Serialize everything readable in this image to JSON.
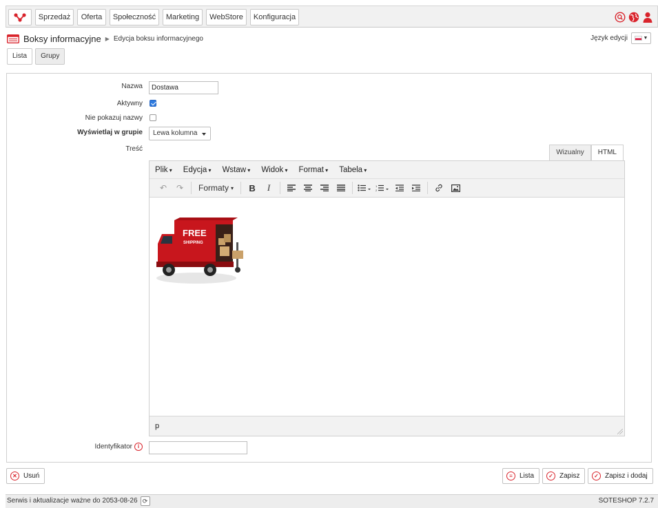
{
  "nav": {
    "items": [
      {
        "label": "Sprzedaż"
      },
      {
        "label": "Oferta"
      },
      {
        "label": "Społeczność"
      },
      {
        "label": "Marketing"
      },
      {
        "label": "WebStore"
      },
      {
        "label": "Konfiguracja"
      }
    ],
    "right_icons": [
      "search-icon",
      "globe-icon",
      "user-icon"
    ]
  },
  "header": {
    "title": "Boksy informacyjne",
    "subtitle": "Edycja boksu informacyjnego",
    "lang_label": "Język edycji",
    "lang_flag": "PL"
  },
  "subtabs": [
    {
      "label": "Lista"
    },
    {
      "label": "Grupy"
    }
  ],
  "form": {
    "name_label": "Nazwa",
    "name_value": "Dostawa",
    "active_label": "Aktywny",
    "active_checked": true,
    "hide_name_label": "Nie pokazuj nazwy",
    "hide_name_checked": false,
    "group_label": "Wyświetlaj w grupie",
    "group_value": "Lewa kolumna",
    "content_label": "Treść",
    "identifier_label": "Identyfikator",
    "identifier_value": ""
  },
  "editor": {
    "mode_tabs": [
      {
        "label": "Wizualny"
      },
      {
        "label": "HTML"
      }
    ],
    "menu": [
      "Plik",
      "Edycja",
      "Wstaw",
      "Widok",
      "Format",
      "Tabela"
    ],
    "formats_label": "Formaty",
    "image_text": {
      "line1": "FREE",
      "line2": "SHIPPING"
    },
    "status_path": "p"
  },
  "actions": {
    "delete": "Usuń",
    "list": "Lista",
    "save": "Zapisz",
    "save_add": "Zapisz i dodaj"
  },
  "footer": {
    "service_text": "Serwis i aktualizacje ważne do 2053-08-26",
    "version": "SOTESHOP 7.2.7"
  },
  "colors": {
    "accent": "#d9242c",
    "truck": "#c8161d"
  }
}
